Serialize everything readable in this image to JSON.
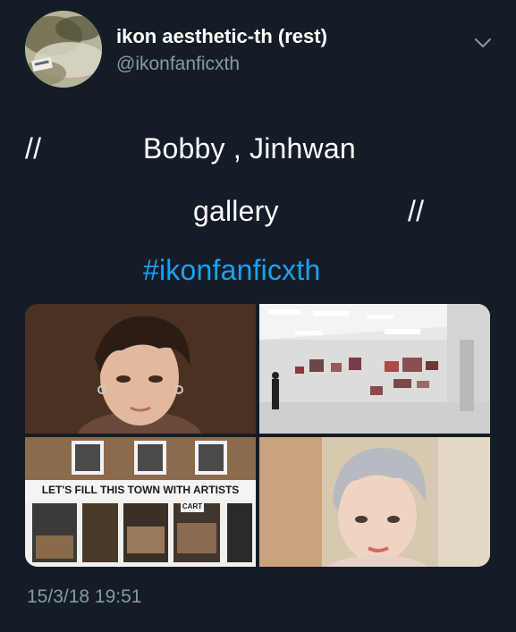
{
  "tweet": {
    "display_name": "ikon aesthetic-th (rest)",
    "handle": "@ikonfanficxth",
    "menu_icon": "chevron-down-icon",
    "lines": {
      "slash_left": "//",
      "names": "Bobby , Jinhwan",
      "gallery": "gallery",
      "slash_right": "//",
      "hashtag": "#ikonfanficxth"
    },
    "timestamp": "15/3/18 19:51"
  },
  "media": {
    "shop_sign": "LET'S FILL THIS TOWN WITH ARTISTS",
    "shop_label": "CART"
  },
  "colors": {
    "background": "#141d26",
    "link": "#1da1f2",
    "secondary_text": "#8899a6"
  }
}
